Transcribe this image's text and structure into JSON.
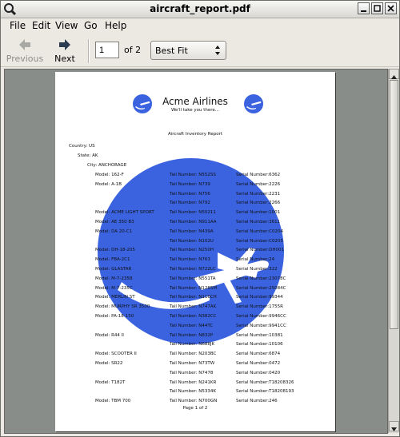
{
  "window": {
    "title": "aircraft_report.pdf"
  },
  "menu": [
    "File",
    "Edit",
    "View",
    "Go",
    "Help"
  ],
  "toolbar": {
    "previous_label": "Previous",
    "next_label": "Next",
    "page_value": "1",
    "of_label": "of 2",
    "zoom_value": "Best Fit"
  },
  "document": {
    "company": "Acme Airlines",
    "tagline": "We'll take you there...",
    "report_title": "Aircraft Inventory Report",
    "country": "Country: US",
    "state": "State: AK",
    "city": "City: ANCHORAGE",
    "footer": "Page 1 of 2",
    "watermark_color": "#3b63e0",
    "rows": [
      {
        "model": "Model: 162-F",
        "tail": "Tail Number: N552SS",
        "serial": "Serial Number:6362"
      },
      {
        "model": "Model: A-1B",
        "tail": "Tail Number: N739",
        "serial": "Serial Number:2226"
      },
      {
        "model": "",
        "tail": "Tail Number: N756",
        "serial": "Serial Number:2231"
      },
      {
        "model": "",
        "tail": "Tail Number: N792",
        "serial": "Serial Number:2266"
      },
      {
        "model": "Model: ACME LIGHT SPORT",
        "tail": "Tail Number: N50211",
        "serial": "Serial Number:1001"
      },
      {
        "model": "Model: AE 350 B3",
        "tail": "Tail Number: N911AA",
        "serial": "Serial Number:3611"
      },
      {
        "model": "Model: DA 20-C1",
        "tail": "Tail Number: N439A",
        "serial": "Serial Number:C0204"
      },
      {
        "model": "",
        "tail": "Tail Number: N102U",
        "serial": "Serial Number:C0205"
      },
      {
        "model": "Model: DH-18-205",
        "tail": "Tail Number: N250H",
        "serial": "Serial Number:DH001"
      },
      {
        "model": "Model: FBA-2C1",
        "tail": "Tail Number: N763",
        "serial": "Serial Number:24"
      },
      {
        "model": "Model: GLASTAR",
        "tail": "Tail Number: N722LC",
        "serial": "Serial Number:322"
      },
      {
        "model": "Model: M-7-235B",
        "tail": "Tail Number: N551TA",
        "serial": "Serial Number:23078C"
      },
      {
        "model": "Model: M-7-235C",
        "tail": "Tail Number: N1285M",
        "serial": "Serial Number:25084C"
      },
      {
        "model": "Model: MERLIN ST",
        "tail": "Tail Number: N116CH",
        "serial": "Serial Number:99344"
      },
      {
        "model": "Model: MURPHY SR 3500",
        "tail": "Tail Number: N747AK",
        "serial": "Serial Number:1755R"
      },
      {
        "model": "Model: PA-18-150",
        "tail": "Tail Number: N382CC",
        "serial": "Serial Number:9946CC"
      },
      {
        "model": "",
        "tail": "Tail Number: N44TC",
        "serial": "Serial Number:9941CC"
      },
      {
        "model": "Model: R44 II",
        "tail": "Tail Number: N832P",
        "serial": "Serial Number:10381"
      },
      {
        "model": "",
        "tail": "Tail Number: N688JK",
        "serial": "Serial Number:10106"
      },
      {
        "model": "Model: SCOOTER II",
        "tail": "Tail Number: N203BC",
        "serial": "Serial Number:6874"
      },
      {
        "model": "Model: SR22",
        "tail": "Tail Number: N73TW",
        "serial": "Serial Number:0472"
      },
      {
        "model": "",
        "tail": "Tail Number: N7478",
        "serial": "Serial Number:0420"
      },
      {
        "model": "Model: T182T",
        "tail": "Tail Number: N241KR",
        "serial": "Serial Number:T18208326"
      },
      {
        "model": "",
        "tail": "Tail Number: N5334K",
        "serial": "Serial Number:T18208193"
      },
      {
        "model": "Model: TBM 700",
        "tail": "Tail Number: N700GN",
        "serial": "Serial Number:246"
      }
    ]
  }
}
